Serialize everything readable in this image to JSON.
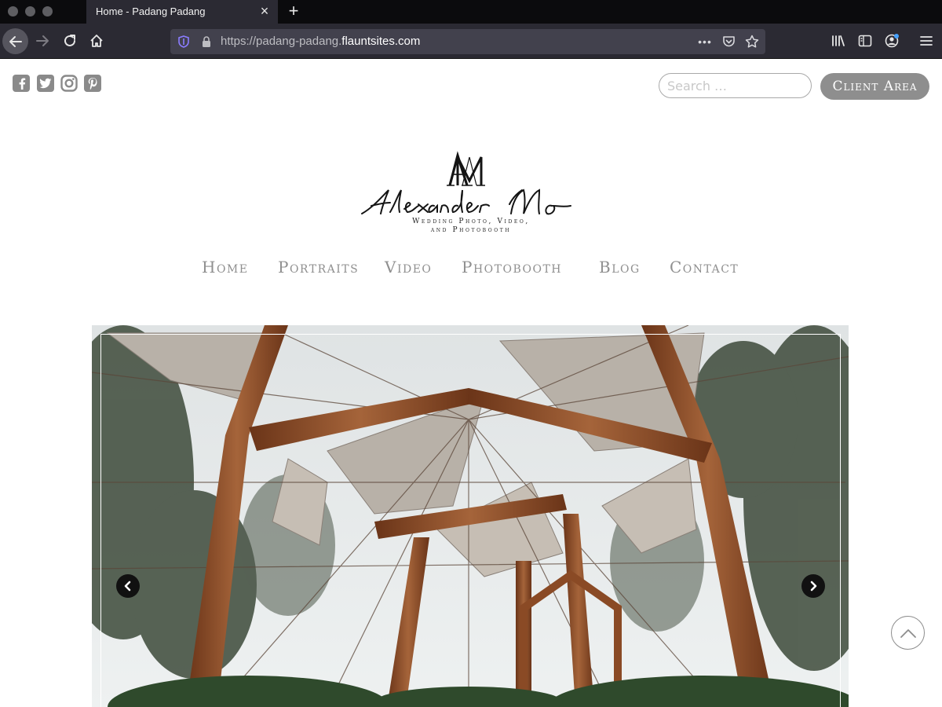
{
  "browser": {
    "tab_title": "Home - Padang Padang",
    "url_prefix": "https://padang-padang.",
    "url_domain": "flauntsites.com",
    "overflow_label": "•••"
  },
  "social_icons": [
    "facebook-icon",
    "twitter-icon",
    "instagram-icon",
    "pinterest-icon"
  ],
  "search": {
    "placeholder": "Search …"
  },
  "client_area_label": "Client Area",
  "logo": {
    "monogram": "AM",
    "name": "Alexander Mo",
    "subtitle_line1": "Wedding Photo, Video,",
    "subtitle_line2": "and Photobooth"
  },
  "nav": [
    "Home",
    "Portraits",
    "Video",
    "Photobooth",
    "Blog",
    "Contact"
  ],
  "colors": {
    "chrome_dark": "#0b0b0d",
    "chrome_bar": "#2b2a33",
    "nav_text": "#8f8f8f",
    "button_gray": "#8e8e8e",
    "wood": "#8a4a25"
  }
}
